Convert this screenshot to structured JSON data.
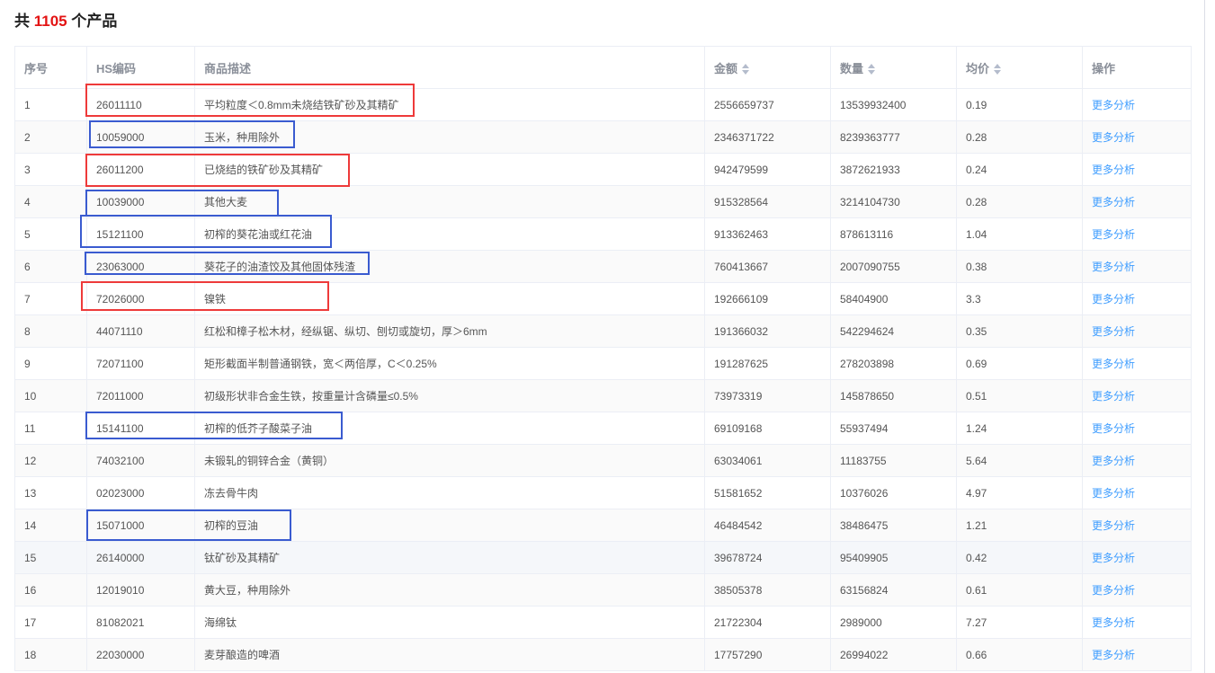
{
  "header": {
    "prefix": "共",
    "count": "1105",
    "suffix": "个产品"
  },
  "columns": [
    "序号",
    "HS编码",
    "商品描述",
    "金额",
    "数量",
    "均价",
    "操作"
  ],
  "action_label": "更多分析",
  "rows": [
    [
      "1",
      "26011110",
      "平均粒度＜0.8mm未烧结铁矿砂及其精矿",
      "2556659737",
      "13539932400",
      "0.19"
    ],
    [
      "2",
      "10059000",
      "玉米，种用除外",
      "2346371722",
      "8239363777",
      "0.28"
    ],
    [
      "3",
      "26011200",
      "已烧结的铁矿砂及其精矿",
      "942479599",
      "3872621933",
      "0.24"
    ],
    [
      "4",
      "10039000",
      "其他大麦",
      "915328564",
      "3214104730",
      "0.28"
    ],
    [
      "5",
      "15121100",
      "初榨的葵花油或红花油",
      "913362463",
      "878613116",
      "1.04"
    ],
    [
      "6",
      "23063000",
      "葵花子的油渣饺及其他固体残渣",
      "760413667",
      "2007090755",
      "0.38"
    ],
    [
      "7",
      "72026000",
      "镍铁",
      "192666109",
      "58404900",
      "3.3"
    ],
    [
      "8",
      "44071110",
      "红松和樟子松木材，经纵锯、纵切、刨切或旋切，厚＞6mm",
      "191366032",
      "542294624",
      "0.35"
    ],
    [
      "9",
      "72071100",
      "矩形截面半制普通钢铁，宽＜两倍厚，C＜0.25%",
      "191287625",
      "278203898",
      "0.69"
    ],
    [
      "10",
      "72011000",
      "初级形状非合金生铁，按重量计含磷量≤0.5%",
      "73973319",
      "145878650",
      "0.51"
    ],
    [
      "11",
      "15141100",
      "初榨的低芥子酸菜子油",
      "69109168",
      "55937494",
      "1.24"
    ],
    [
      "12",
      "74032100",
      "未锻轧的铜锌合金（黄铜）",
      "63034061",
      "11183755",
      "5.64"
    ],
    [
      "13",
      "02023000",
      "冻去骨牛肉",
      "51581652",
      "10376026",
      "4.97"
    ],
    [
      "14",
      "15071000",
      "初榨的豆油",
      "46484542",
      "38486475",
      "1.21"
    ],
    [
      "15",
      "26140000",
      "钛矿砂及其精矿",
      "39678724",
      "95409905",
      "0.42"
    ],
    [
      "16",
      "12019010",
      "黄大豆，种用除外",
      "38505378",
      "63156824",
      "0.61"
    ],
    [
      "17",
      "81082021",
      "海绵钛",
      "21722304",
      "2989000",
      "7.27"
    ],
    [
      "18",
      "22030000",
      "麦芽酿造的啤酒",
      "17757290",
      "26994022",
      "0.66"
    ]
  ]
}
